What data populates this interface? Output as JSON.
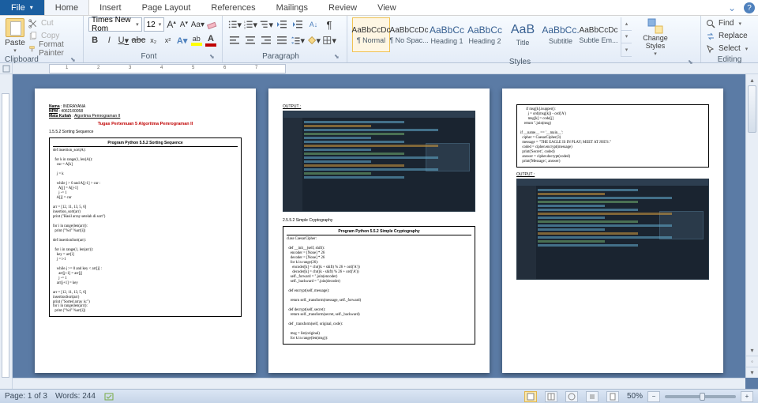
{
  "tabs": {
    "file": "File",
    "items": [
      "Home",
      "Insert",
      "Page Layout",
      "References",
      "Mailings",
      "Review",
      "View"
    ],
    "activeIndex": 0
  },
  "window_controls": {
    "help": "?",
    "min": "⌄"
  },
  "ribbon": {
    "clipboard": {
      "label": "Clipboard",
      "paste": "Paste",
      "cut": "Cut",
      "copy": "Copy",
      "format_painter": "Format Painter"
    },
    "font": {
      "label": "Font",
      "name": "Times New Rom",
      "size": "12",
      "bold": "B",
      "italic": "I",
      "underline": "U",
      "strike": "abc",
      "sub": "x₂",
      "sup": "x²",
      "grow": "A",
      "shrink": "A",
      "case": "Aa",
      "clear": "⌫"
    },
    "paragraph": {
      "label": "Paragraph"
    },
    "styles": {
      "label": "Styles",
      "items": [
        {
          "sample": "AaBbCcDc",
          "name": "¶ Normal",
          "selected": true,
          "color": ""
        },
        {
          "sample": "AaBbCcDc",
          "name": "¶ No Spac...",
          "selected": false,
          "color": ""
        },
        {
          "sample": "AaBbCc",
          "name": "Heading 1",
          "selected": false,
          "color": "blue"
        },
        {
          "sample": "AaBbCc",
          "name": "Heading 2",
          "selected": false,
          "color": "blue"
        },
        {
          "sample": "AaB",
          "name": "Title",
          "selected": false,
          "color": "blue"
        },
        {
          "sample": "AaBbCc.",
          "name": "Subtitle",
          "selected": false,
          "color": "blue"
        },
        {
          "sample": "AaBbCcDc",
          "name": "Subtle Em...",
          "selected": false,
          "color": ""
        }
      ],
      "change": "Change\nStyles"
    },
    "editing": {
      "label": "Editing",
      "find": "Find",
      "replace": "Replace",
      "select": "Select"
    }
  },
  "ruler": {
    "marks": [
      "1",
      "2",
      "3",
      "4",
      "5",
      "6",
      "7"
    ]
  },
  "status": {
    "page": "Page: 1 of 3",
    "words": "Words: 244",
    "zoom": "50%",
    "minus": "−",
    "plus": "+"
  },
  "doc": {
    "page1": {
      "meta_name_label": "Nama",
      "meta_name": "INDRAYANA",
      "meta_npm_label": "NPM",
      "meta_npm": "4062100058",
      "meta_mk_label": "Mata Kuliah",
      "meta_mk": "Algoritma Pemrograman II",
      "title": "Tugas Pertemuan 5 Algoritma Pemrograman II",
      "sec1": "1.5.5.2 Sorting Sequence",
      "box1_title": "Program Python 5.5.2 Sorting Sequence",
      "box1_code": "def insertion_sort(A):\n\n  for k in range(1, len(A)):\n    cur = A[k]\n\n    j = k\n\n    while j > 0 and A[j-1] > cur :\n      A[j] = A[j-1]\n      j -= 1\n    A[j] = cur\n\narr = [12, 11, 13, 5, 6]\ninsertion_sort(arr)\nprint (\"Hasil array setelah di sort\")\n\nfor i in range(len(arr)):\n  print (\"%d\" %arr[i])\n\ndef insertionSort(arr):\n\n  for i in range(1, len(arr)):\n    key = arr[i]\n    j = i-1\n\n    while j >= 0 and key < arr[j] :\n      arr[j+1] = arr[j]\n      j -= 1\n    arr[j+1] = key\n\narr = [12, 11, 13, 5, 6]\ninsertionSort(arr)\nprint (\"Sorted array is:\")\nfor i in range(len(arr)):\n  print (\"%d\" %arr[i])"
    },
    "page2": {
      "out": "OUTPUT :",
      "sec2": "2.5.5.2 Simple  Cryptography",
      "box2_title": "Program Python 5.5.2 Simple  Cryptography",
      "box2_code": "class CaesarCipher:\n\n  def __init__(self, shift):\n    encoder = [None] * 26\n    decoder = [None] * 26\n    for k in range(26):\n      encoder[k] = chr((k + shift) % 26 + ord('A'))\n      decoder[k] = chr((k - shift) % 26 + ord('A'))\n    self._forward = ''.join(encoder)\n    self._backward = ''.join(decoder)\n\n  def encrypt(self, message):\n\n    return self._transform(message, self._forward)\n\n  def decrypt(self, secret):\n    return self._transform(secret, self._backward)\n\n  def _transform(self, original, code):\n\n    msg = list(original)\n    for k in range(len(msg)):"
    },
    "page3": {
      "box3_code": "      if msg[k].isupper():\n        j = ord(msg[k]) - ord('A')\n        msg[k] = code[j]\n    return ''.join(msg)\n\nif __name__ == '__main__':\n  cipher = CaesarCipher(3)\n  message = \"THE EAGLE IS IN PLAY; MEET AT JOE'S.\"\n  coded = cipher.encrypt(message)\n  print('Secret:', coded)\n  answer = cipher.decrypt(coded)\n  print('Message:', answer)",
      "out": "OUTPUT :"
    }
  }
}
